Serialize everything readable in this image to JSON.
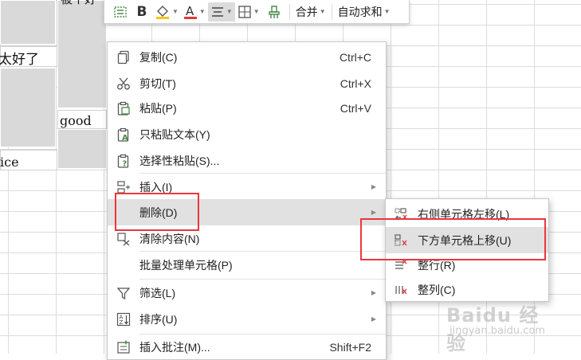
{
  "sheet": {
    "cells": {
      "partial_top": "被个好",
      "row2_text": "太好了",
      "good_text": "good",
      "nice_text": "ice"
    }
  },
  "mini_toolbar": {
    "merge_label": "合并",
    "autosum_label": "自动求和",
    "font_color": "#e53935",
    "fill_color": "#f5c518"
  },
  "context_menu": {
    "items": [
      {
        "label": "复制(C)",
        "shortcut": "Ctrl+C",
        "icon": "copy-icon"
      },
      {
        "label": "剪切(T)",
        "shortcut": "Ctrl+X",
        "icon": "scissors-icon"
      },
      {
        "label": "粘贴(P)",
        "shortcut": "Ctrl+V",
        "icon": "paste-icon"
      },
      {
        "label": "只粘贴文本(Y)",
        "shortcut": "",
        "icon": "paste-text-icon"
      },
      {
        "label": "选择性粘贴(S)...",
        "shortcut": "",
        "icon": "paste-special-icon"
      },
      {
        "label": "插入(I)",
        "shortcut": "",
        "icon": "insert-icon"
      },
      {
        "label": "删除(D)",
        "shortcut": "",
        "icon": ""
      },
      {
        "label": "清除内容(N)",
        "shortcut": "",
        "icon": "clear-icon"
      },
      {
        "label": "批量处理单元格(P)",
        "shortcut": "",
        "icon": ""
      },
      {
        "label": "筛选(L)",
        "shortcut": "",
        "icon": "filter-icon"
      },
      {
        "label": "排序(U)",
        "shortcut": "",
        "icon": "sort-icon"
      },
      {
        "label": "插入批注(M)...",
        "shortcut": "Shift+F2",
        "icon": "comment-icon"
      }
    ]
  },
  "delete_submenu": {
    "items": [
      {
        "label": "右侧单元格左移(L)",
        "icon": "shift-left-icon"
      },
      {
        "label": "下方单元格上移(U)",
        "icon": "shift-up-icon"
      },
      {
        "label": "整行(R)",
        "icon": "delete-row-icon"
      },
      {
        "label": "整列(C)",
        "icon": "delete-column-icon"
      }
    ]
  },
  "watermark": {
    "brand": "Baidu 经验",
    "url": "jingyan.baidu.com"
  }
}
